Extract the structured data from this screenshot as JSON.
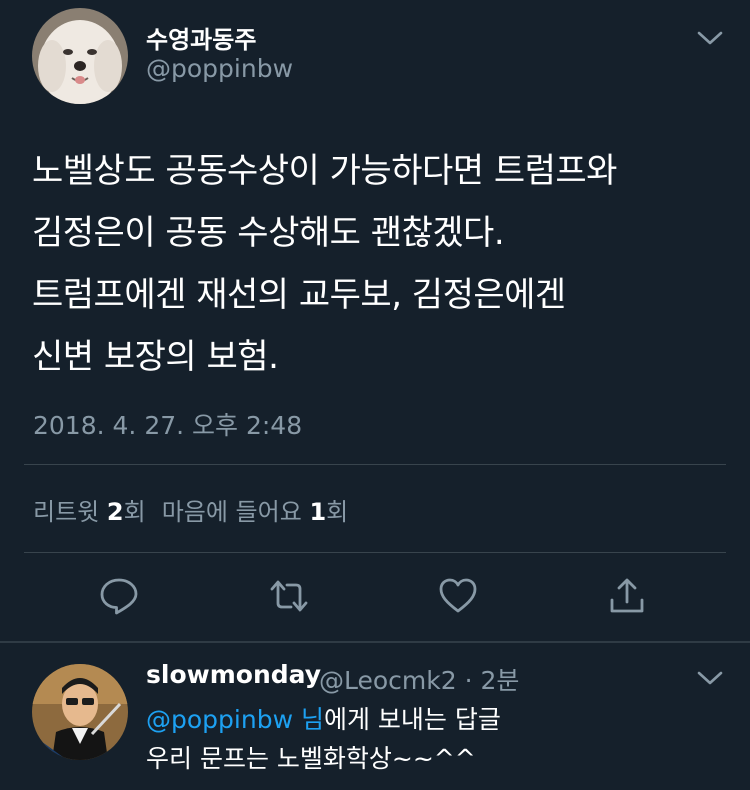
{
  "main_tweet": {
    "author_name": "수영과동주",
    "author_handle": "@poppinbw",
    "text": "노벨상도 공동수상이 가능하다면 트럼프와\n김정은이 공동 수상해도 괜찮겠다.\n트럼프에겐 재선의 교두보, 김정은에겐\n신변 보장의 보험.",
    "timestamp": "2018. 4. 27. 오후 2:48",
    "stats": {
      "retweet_label": "리트윗",
      "retweet_count": "2",
      "retweet_unit": "회",
      "like_label": "마음에 들어요",
      "like_count": "1",
      "like_unit": "회"
    }
  },
  "actions": {
    "reply_icon": "reply-icon",
    "retweet_icon": "retweet-icon",
    "like_icon": "heart-icon",
    "share_icon": "share-icon"
  },
  "reply_tweet": {
    "author_name": "slowmonday",
    "author_handle_time": "@Leocmk2 · 2분",
    "reply_to_mention": "@poppinbw 님",
    "reply_to_suffix": "에게 보내는 답글",
    "text": "우리 문프는 노벨화학상~~^^"
  },
  "colors": {
    "background": "#15202b",
    "secondary_text": "#8899a6",
    "accent": "#1da1f2",
    "divider": "#38444d"
  }
}
